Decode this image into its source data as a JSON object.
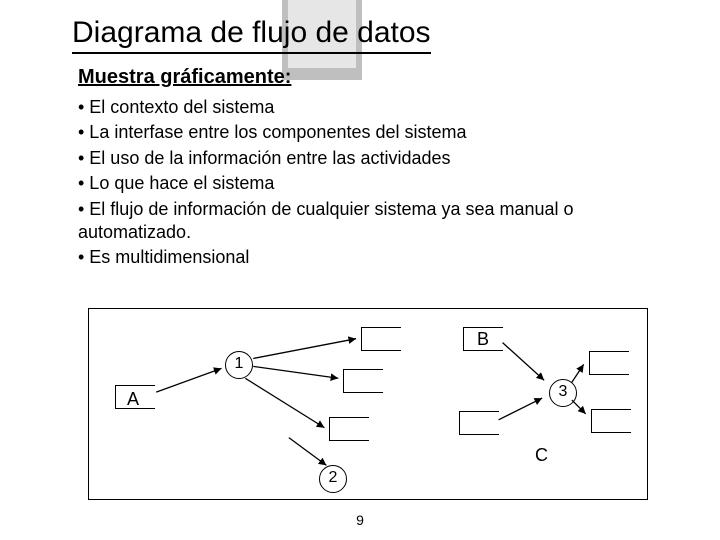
{
  "title": "Diagrama de flujo de datos",
  "subtitle": "Muestra gráficamente:",
  "bullets": [
    "• El contexto del sistema",
    "• La interfase entre los componentes del sistema",
    "• El uso de la información entre las actividades",
    "• Lo que hace el sistema",
    "• El flujo de información de cualquier sistema ya sea manual o automatizado.",
    "• Es multidimensional"
  ],
  "diagram": {
    "nodes": {
      "n1": "1",
      "n2": "2",
      "n3": "3"
    },
    "labels": {
      "A": "A",
      "B": "B",
      "C": "C"
    }
  },
  "pageNumber": "9"
}
